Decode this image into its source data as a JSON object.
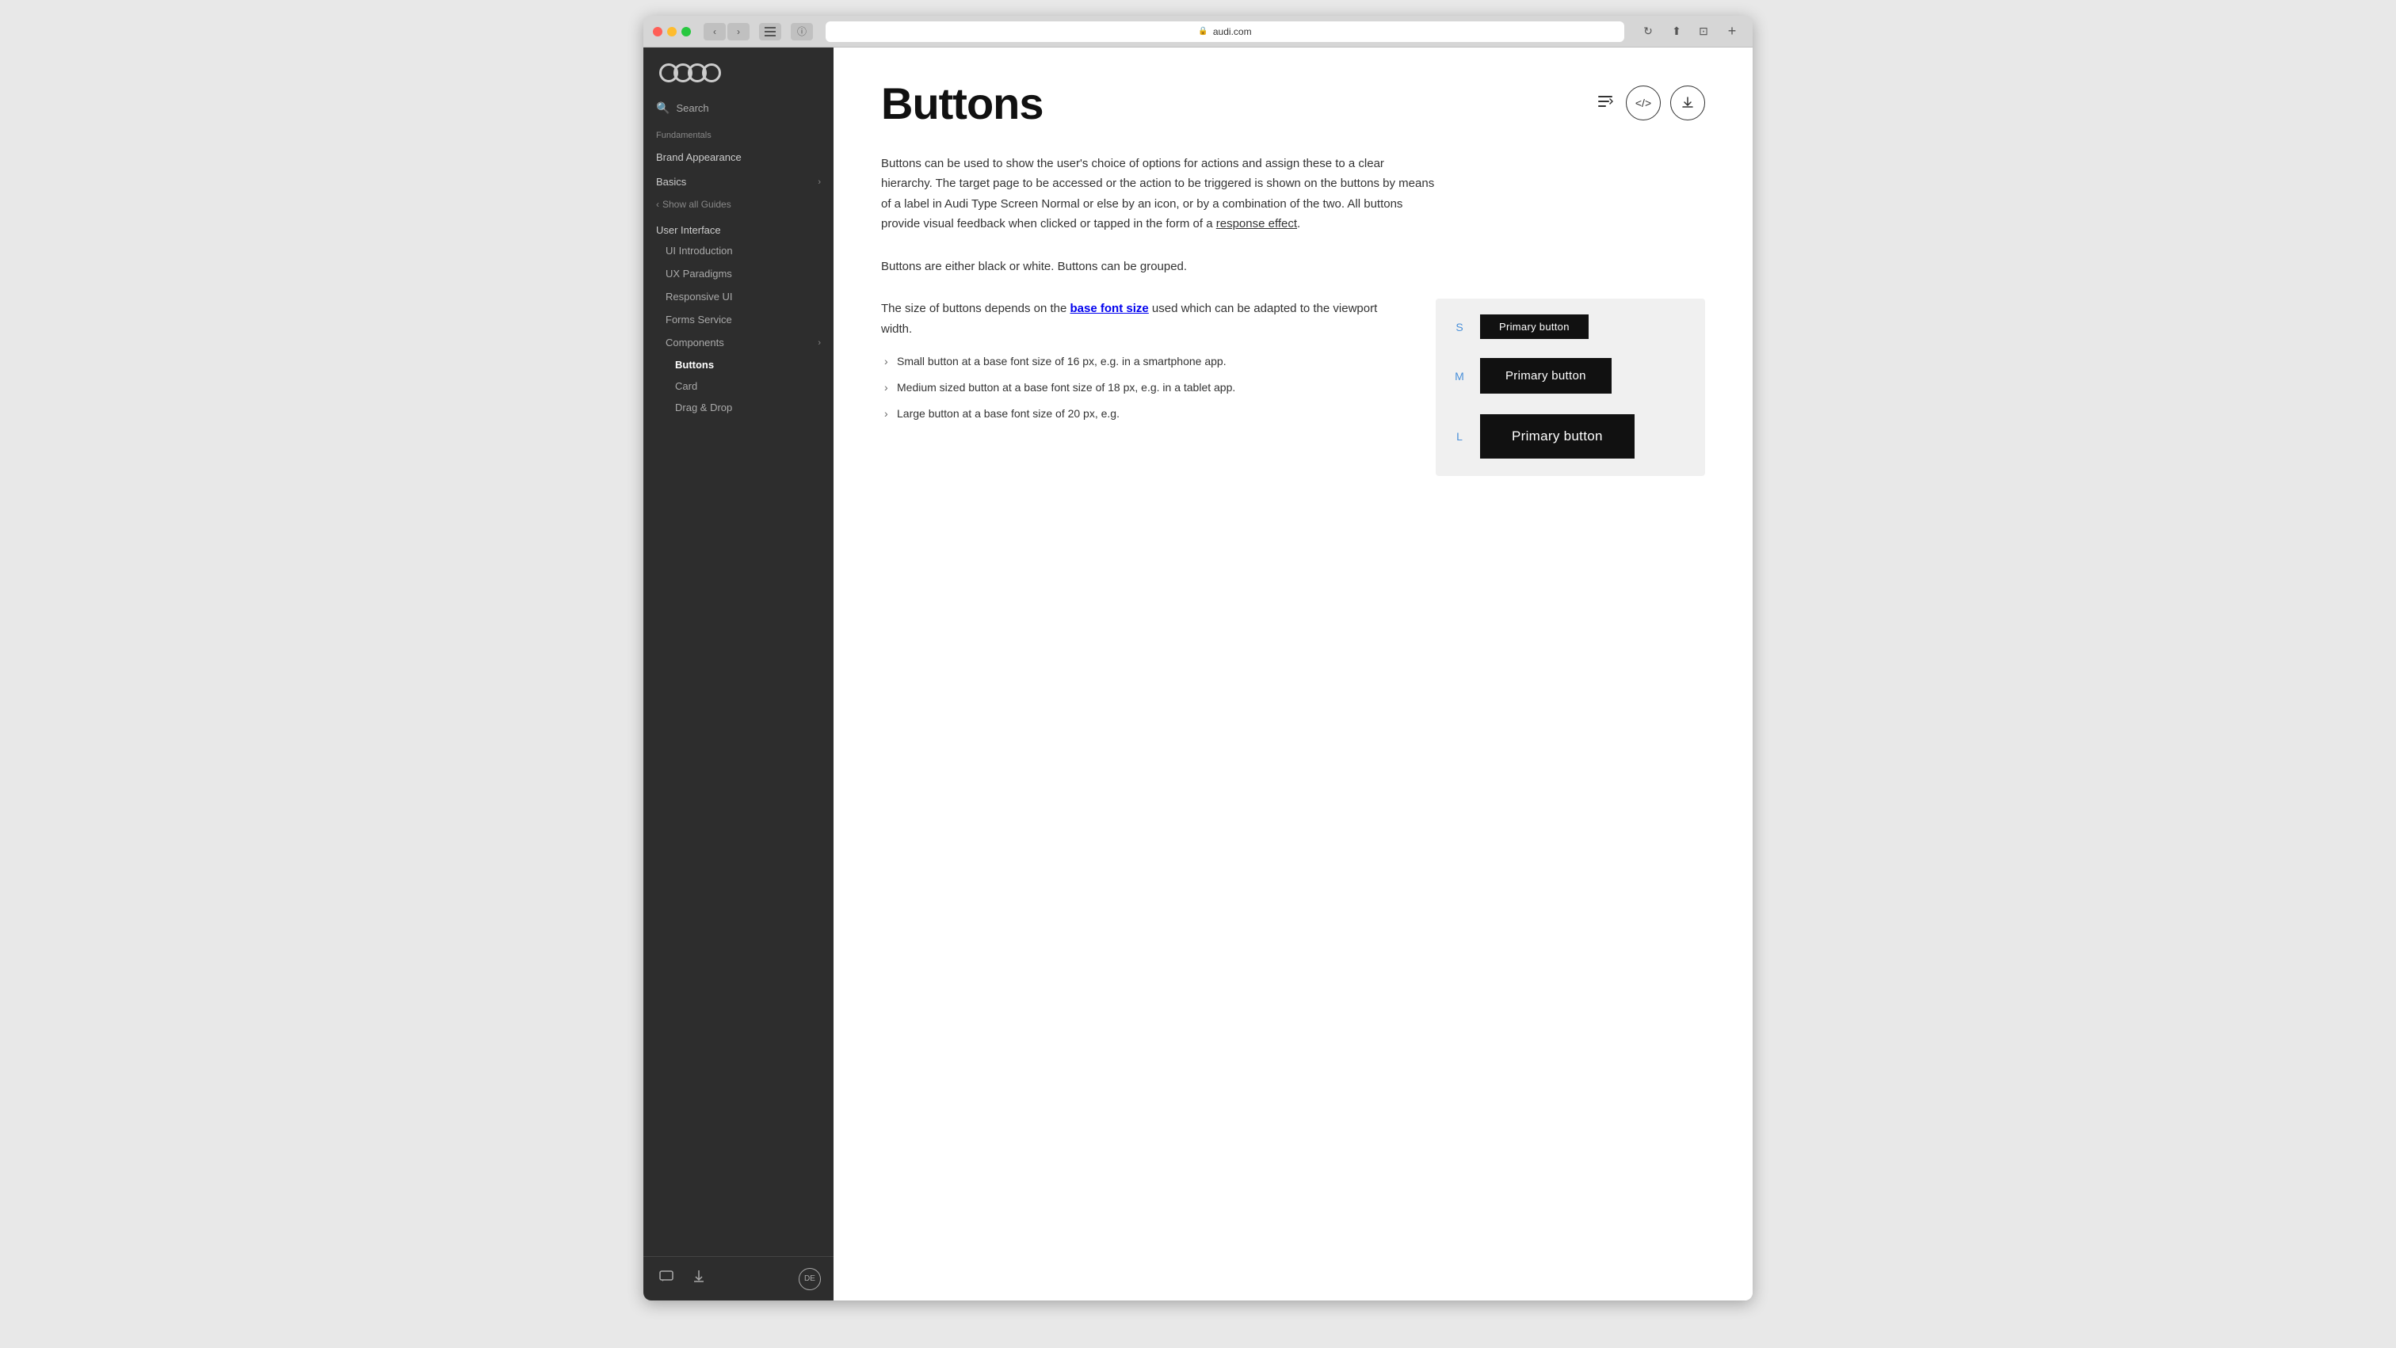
{
  "browser": {
    "url": "audi.com",
    "new_tab_label": "+"
  },
  "sidebar": {
    "logo_alt": "Audi logo",
    "search_placeholder": "Search",
    "fundamentals_label": "Fundamentals",
    "brand_appearance_label": "Brand Appearance",
    "basics_label": "Basics",
    "show_all_guides_label": "Show all Guides",
    "user_interface_label": "User Interface",
    "nav_items": [
      {
        "label": "UI Introduction",
        "active": false
      },
      {
        "label": "UX Paradigms",
        "active": false
      },
      {
        "label": "Responsive UI",
        "active": false
      },
      {
        "label": "Forms Service",
        "active": false
      },
      {
        "label": "Components",
        "active": false,
        "has_children": true
      }
    ],
    "components_items": [
      {
        "label": "Buttons",
        "active": true
      },
      {
        "label": "Card",
        "active": false
      },
      {
        "label": "Drag & Drop",
        "active": false
      }
    ],
    "footer": {
      "comment_icon": "💬",
      "download_icon": "⬇",
      "lang_label": "DE"
    }
  },
  "main": {
    "page_title": "Buttons",
    "description_p1": "Buttons can be used to show the user's choice of options for actions and assign these to a clear hierarchy. The target page to be accessed or the action to be triggered is shown on the buttons by means of a label in Audi Type Screen Normal or else by an icon, or by a combination of the two. All buttons provide visual feedback when clicked or tapped in the form of a",
    "response_effect_link": "response effect",
    "description_p1_end": ".",
    "description_p2": "Buttons are either black or white. Buttons can be grouped.",
    "font_size_text_1": "The size of buttons depends on the",
    "base_font_size_link": "base font size",
    "font_size_text_2": "used which can be adapted to the viewport width.",
    "bullet_items": [
      "Small button at a base font size of 16 px, e.g. in a smartphone app.",
      "Medium sized button at a base font size of 18 px, e.g. in a tablet app.",
      "Large button at a base font size of 20 px, e.g."
    ],
    "preview": {
      "size_s_label": "S",
      "size_m_label": "M",
      "size_l_label": "L",
      "button_s_label": "Primary button",
      "button_m_label": "Primary button",
      "button_l_label": "Primary button"
    },
    "header_icons": {
      "list_icon": "≡",
      "code_icon": "</>",
      "download_icon": "⬇"
    }
  }
}
